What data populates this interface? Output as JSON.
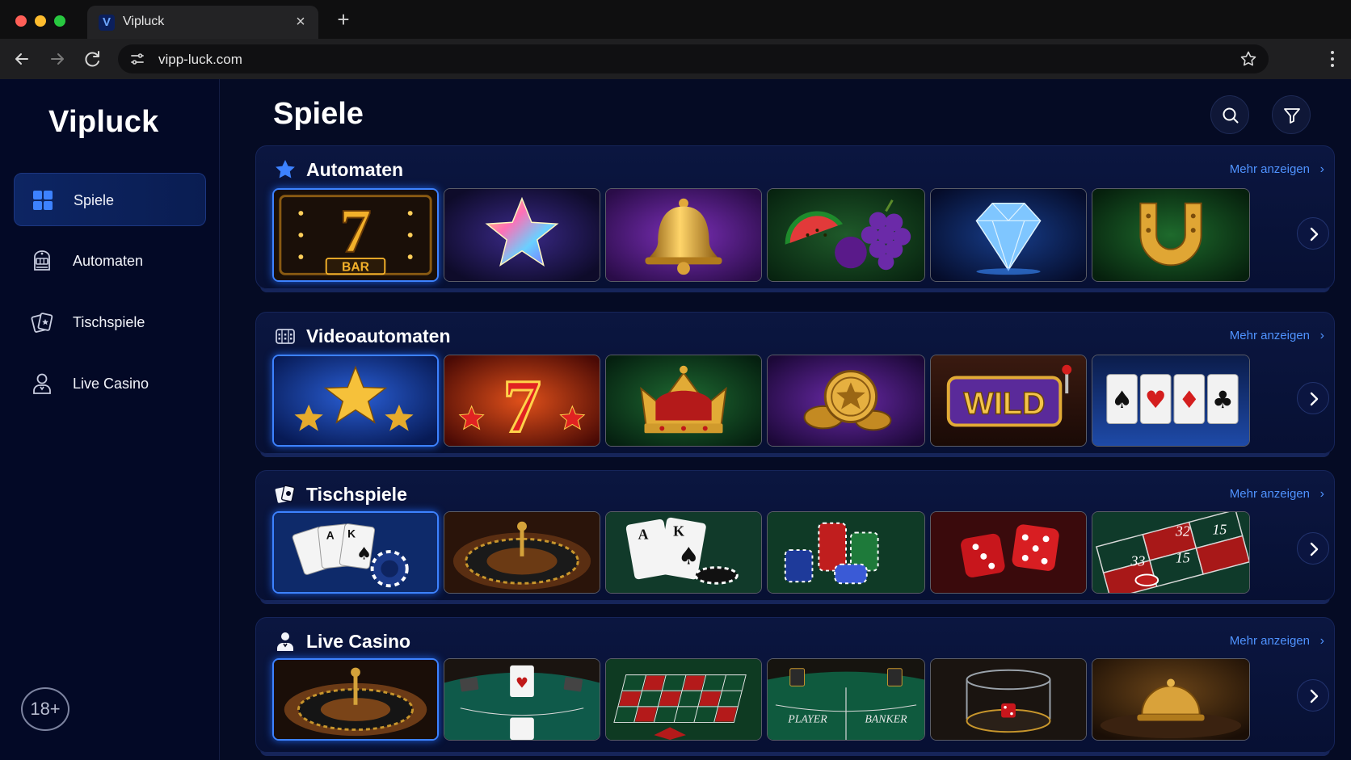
{
  "browser": {
    "tab_title": "Vipluck",
    "tab_favicon_letter": "V",
    "url": "vipp-luck.com"
  },
  "sidebar": {
    "logo": "Vipluck",
    "items": [
      {
        "label": "Spiele",
        "icon": "grid-icon",
        "active": true
      },
      {
        "label": "Automaten",
        "icon": "slot-machine-icon",
        "active": false
      },
      {
        "label": "Tischspiele",
        "icon": "cards-icon",
        "active": false
      },
      {
        "label": "Live Casino",
        "icon": "dealer-icon",
        "active": false
      }
    ],
    "age_badge": "18+"
  },
  "main": {
    "title": "Spiele",
    "search_icon": "search-icon",
    "filter_icon": "filter-icon",
    "sections": [
      {
        "title": "Automaten",
        "icon": "star-icon",
        "more": "Mehr anzeigen",
        "games": [
          "lucky-seven-bar",
          "rainbow-star",
          "golden-bell",
          "watermelon-plum-grapes",
          "blue-diamond",
          "golden-horseshoe"
        ]
      },
      {
        "title": "Videoautomaten",
        "icon": "video-slot-icon",
        "more": "Mehr anzeigen",
        "games": [
          "golden-stars",
          "fire-seven",
          "royal-crown",
          "gold-coins",
          "wild-reels",
          "card-suits-reels"
        ]
      },
      {
        "title": "Tischspiele",
        "icon": "table-games-icon",
        "more": "Mehr anzeigen",
        "games": [
          "aces-poker",
          "roulette-wheel",
          "ace-king-chips",
          "chip-stacks",
          "red-dice",
          "roulette-table"
        ]
      },
      {
        "title": "Live Casino",
        "icon": "live-dealer-icon",
        "more": "Mehr anzeigen",
        "games": [
          "live-roulette",
          "blackjack-table",
          "roulette-layout",
          "baccarat-player-banker",
          "dice-shaker",
          "bell-table"
        ]
      }
    ]
  },
  "colors": {
    "accent": "#3d82ff",
    "link": "#4f93ff",
    "background": "#050b24"
  }
}
